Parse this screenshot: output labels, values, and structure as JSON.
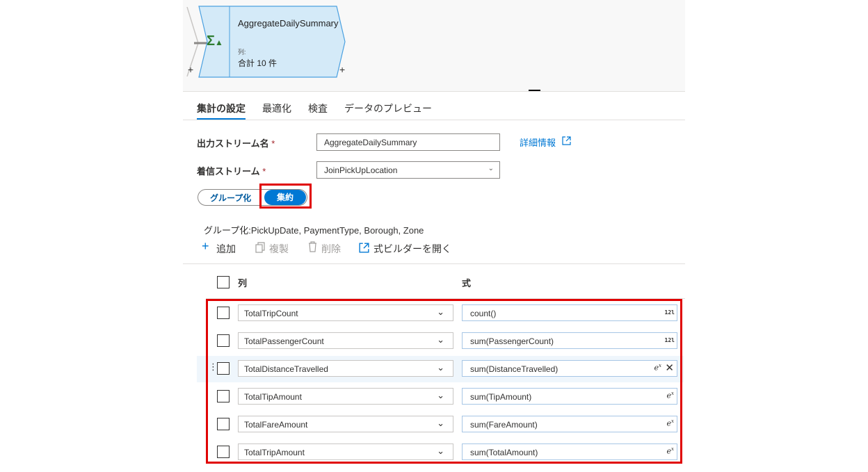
{
  "node": {
    "title": "AggregateDailySummary",
    "sub_label": "列:",
    "sub_value": "合計 10 件",
    "plus": "+"
  },
  "tabs": [
    {
      "label": "集計の設定",
      "active": true
    },
    {
      "label": "最適化",
      "active": false
    },
    {
      "label": "検査",
      "active": false
    },
    {
      "label": "データのプレビュー",
      "active": false
    }
  ],
  "form": {
    "output_stream_label": "出力ストリーム名",
    "output_stream_value": "AggregateDailySummary",
    "required_mark": "*",
    "learn_more": "詳細情報",
    "incoming_stream_label": "着信ストリーム",
    "incoming_stream_value": "JoinPickUpLocation"
  },
  "toggle": {
    "group_by": "グループ化",
    "aggregates": "集約",
    "selected": "集約"
  },
  "group_by_text": "グループ化:PickUpDate, PaymentType, Borough, Zone",
  "toolbar": {
    "add": "追加",
    "clone": "複製",
    "delete": "削除",
    "open_builder": "式ビルダーを開く"
  },
  "table": {
    "col_header": "列",
    "expr_header": "式",
    "rows": [
      {
        "column": "TotalTripCount",
        "expression": "count()",
        "type_icon": "12l"
      },
      {
        "column": "TotalPassengerCount",
        "expression": "sum(PassengerCount)",
        "type_icon": "12l"
      },
      {
        "column": "TotalDistanceTravelled",
        "expression": "sum(DistanceTravelled)",
        "type_icon": "ex"
      },
      {
        "column": "TotalTipAmount",
        "expression": "sum(TipAmount)",
        "type_icon": "ex"
      },
      {
        "column": "TotalFareAmount",
        "expression": "sum(FareAmount)",
        "type_icon": "ex"
      },
      {
        "column": "TotalTripAmount",
        "expression": "sum(TotalAmount)",
        "type_icon": "ex"
      }
    ]
  },
  "colors": {
    "accent": "#0078d4",
    "highlight_box": "#e00000",
    "node_fill": "#d4eaf8",
    "node_border": "#4aa0e0"
  }
}
